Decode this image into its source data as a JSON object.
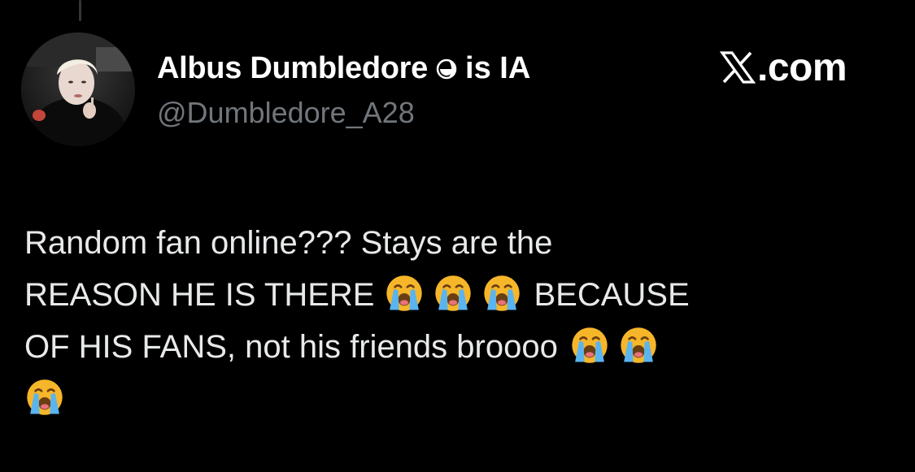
{
  "tweet": {
    "author": {
      "display_name": "Albus Dumbledore",
      "name_icon": "moon-icon",
      "name_suffix": "is IA",
      "handle": "@Dumbledore_A28",
      "avatar": "profile-photo"
    },
    "site": {
      "logo_icon": "x-logo-icon",
      "domain": ".com"
    },
    "body": {
      "line1": "Random fan online??? Stays are the",
      "line2_a": "REASON HE IS THERE",
      "line2_b": "BECAUSE",
      "line3_a": "OF HIS FANS, not his friends broooo",
      "emoji": "loudly-crying-face-emoji"
    }
  },
  "colors": {
    "background": "#000000",
    "text": "#e7e9ea",
    "handle": "#71767b",
    "emoji_face": "#f6b62a",
    "emoji_tears": "#5ab4f0"
  }
}
